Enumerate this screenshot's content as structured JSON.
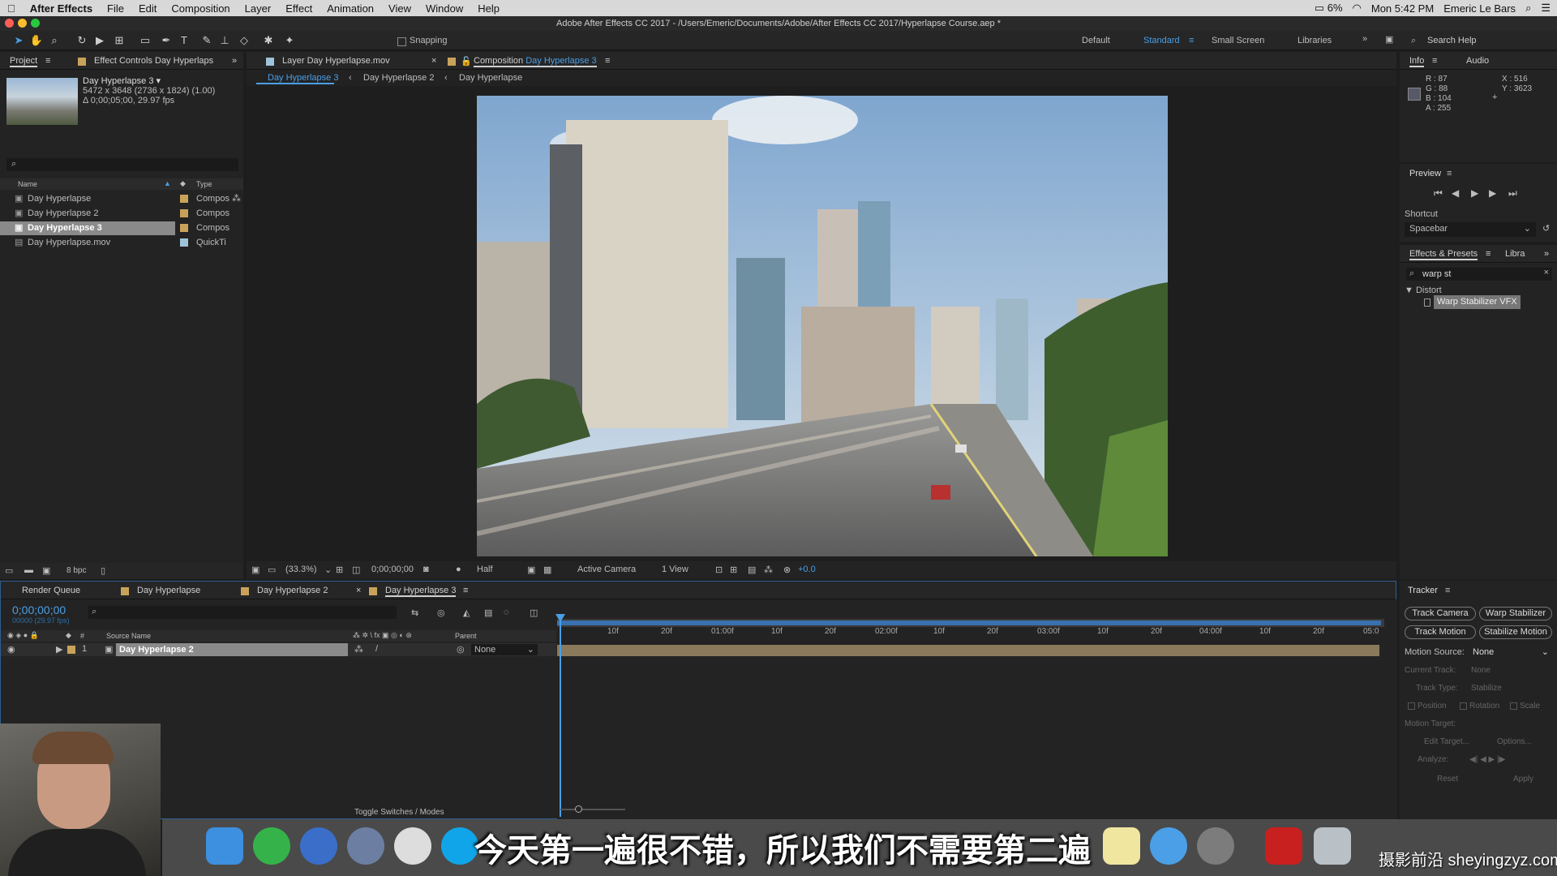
{
  "menubar": {
    "app": "After Effects",
    "items": [
      "File",
      "Edit",
      "Composition",
      "Layer",
      "Effect",
      "Animation",
      "View",
      "Window",
      "Help"
    ],
    "battery": "6%",
    "clock": "Mon 5:42 PM",
    "user": "Emeric Le Bars"
  },
  "window_title": "Adobe After Effects CC 2017 - /Users/Emeric/Documents/Adobe/After Effects CC 2017/Hyperlapse Course.aep *",
  "toolbar": {
    "snapping": "Snapping",
    "workspaces": [
      "Default",
      "Standard",
      "Small Screen",
      "Libraries"
    ],
    "search_placeholder": "Search Help"
  },
  "project": {
    "tab": "Project",
    "effect_controls": "Effect Controls Day Hyperlaps",
    "selected_name": "Day Hyperlapse 3 ▾",
    "selected_dims": "5472 x 3648 (2736 x 1824) (1.00)",
    "selected_dur": "Δ 0;00;05;00, 29.97 fps",
    "col_name": "Name",
    "col_type": "Type",
    "items": [
      {
        "name": "Day Hyperlapse",
        "type": "Compos"
      },
      {
        "name": "Day Hyperlapse 2",
        "type": "Compos"
      },
      {
        "name": "Day Hyperlapse 3",
        "type": "Compos"
      },
      {
        "name": "Day Hyperlapse.mov",
        "type": "QuickTi"
      }
    ],
    "bpc": "8 bpc"
  },
  "viewer": {
    "layer_tab": "Layer Day Hyperlapse.mov",
    "comp_tab_prefix": "Composition",
    "comp_tab_name": "Day Hyperlapse 3",
    "breadcrumbs": [
      "Day Hyperlapse 3",
      "Day Hyperlapse 2",
      "Day Hyperlapse"
    ],
    "zoom": "(33.3%)",
    "timecode": "0;00;00;00",
    "resolution": "Half",
    "camera": "Active Camera",
    "views": "1 View",
    "exposure": "+0.0"
  },
  "info": {
    "tab": "Info",
    "audio": "Audio",
    "r": "R : 87",
    "g": "G : 88",
    "b": "B : 104",
    "a": "A : 255",
    "x": "X : 516",
    "y": "Y : 3623",
    "swatch": "#575868"
  },
  "preview": {
    "title": "Preview",
    "shortcut_label": "Shortcut",
    "shortcut": "Spacebar"
  },
  "effects": {
    "tab": "Effects & Presets",
    "libra": "Libra",
    "search": "warp st",
    "category": "▼ Distort",
    "item": "Warp Stabilizer VFX"
  },
  "timeline": {
    "tabs": [
      "Render Queue",
      "Day Hyperlapse",
      "Day Hyperlapse 2",
      "Day Hyperlapse 3"
    ],
    "timecode": "0;00;00;00",
    "fps": "00000 (29.97 fps)",
    "col_source": "Source Name",
    "col_parent": "Parent",
    "layer_index": "1",
    "layer_name": "Day Hyperlapse 2",
    "parent": "None",
    "toggle": "Toggle Switches / Modes",
    "ticks": [
      "10f",
      "20f",
      "01:00f",
      "10f",
      "20f",
      "02:00f",
      "10f",
      "20f",
      "03:00f",
      "10f",
      "20f",
      "04:00f",
      "10f",
      "20f",
      "05:0"
    ]
  },
  "tracker": {
    "title": "Tracker",
    "track_camera": "Track Camera",
    "warp_stabilizer": "Warp Stabilizer",
    "track_motion": "Track Motion",
    "stabilize_motion": "Stabilize Motion",
    "motion_source_label": "Motion Source:",
    "motion_source": "None",
    "current_track": "Current Track:",
    "current_track_val": "None",
    "track_type": "Track Type:",
    "track_type_val": "Stabilize",
    "position": "Position",
    "rotation": "Rotation",
    "scale": "Scale",
    "motion_target": "Motion Target:",
    "edit_target": "Edit Target...",
    "options": "Options...",
    "analyze": "Analyze:",
    "reset": "Reset",
    "apply": "Apply"
  },
  "subtitle": "今天第一遍很不错，所以我们不需要第二遍",
  "watermark": "摄影前沿 sheyingzyz.com",
  "colors": {
    "accent": "#4a9fe6",
    "ae_dark": "#232323"
  }
}
